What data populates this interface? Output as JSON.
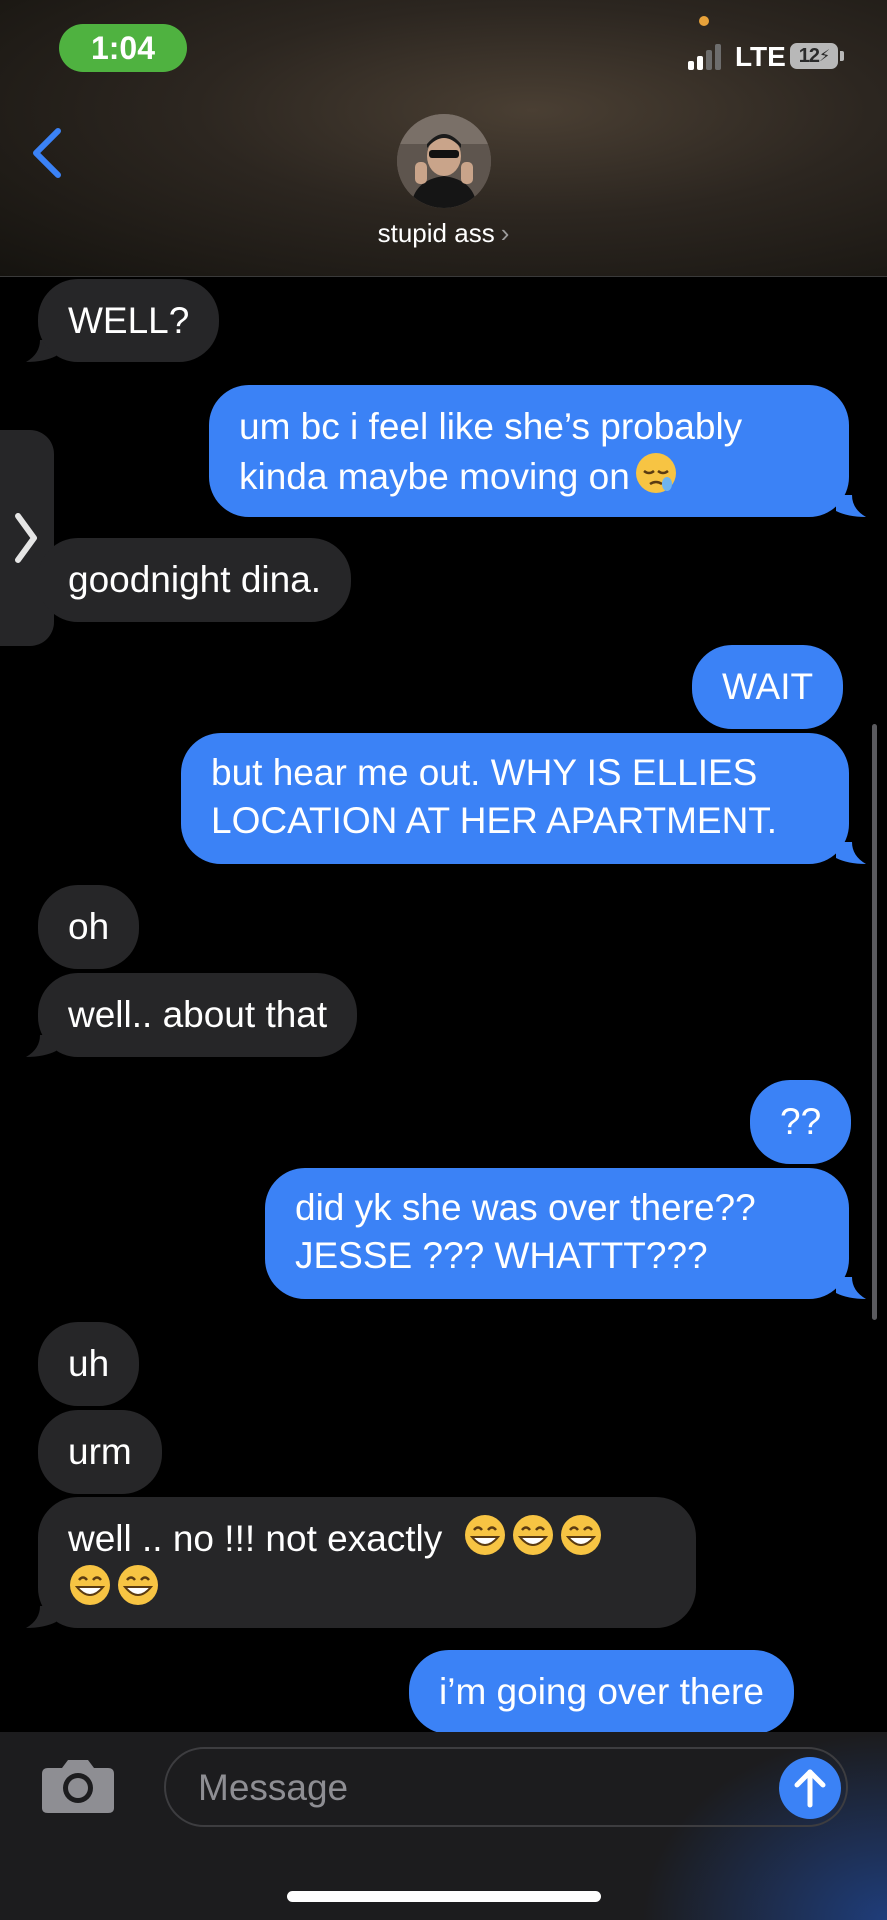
{
  "status_bar": {
    "time": "1:04",
    "network": "LTE",
    "battery": "12"
  },
  "header": {
    "contact_name": "stupid ass",
    "name_chevron": "›"
  },
  "messages": [
    {
      "side": "received",
      "text": "WELL?"
    },
    {
      "side": "sent",
      "lines": [
        "um bc i feel like she’s probably",
        "kinda maybe moving on"
      ],
      "emoji": "😪"
    },
    {
      "side": "received",
      "text": "goodnight dina."
    },
    {
      "side": "sent",
      "text": "WAIT"
    },
    {
      "side": "sent",
      "lines": [
        "but hear me out. WHY IS ELLIES",
        "LOCATION AT HER APARTMENT."
      ]
    },
    {
      "side": "received",
      "text": "oh"
    },
    {
      "side": "received",
      "text": "well.. about that"
    },
    {
      "side": "sent",
      "text": "??"
    },
    {
      "side": "sent",
      "lines": [
        "did yk she was over there??",
        "JESSE ??? WHATTT???"
      ]
    },
    {
      "side": "received",
      "text": "uh"
    },
    {
      "side": "received",
      "text": "urm"
    },
    {
      "side": "received",
      "lines": [
        "well .. no !!! not exactly",
        ""
      ],
      "emoji": "😁"
    },
    {
      "side": "sent",
      "text": "i’m going over there"
    }
  ],
  "composer": {
    "placeholder": "Message"
  },
  "icons": [
    "back-chevron-icon",
    "camera-icon",
    "send-arrow-icon",
    "drawer-chevron-icon"
  ],
  "colors": {
    "sent_bubble": "#3b82f6",
    "received_bubble": "#262628",
    "time_pill": "#4fb240"
  }
}
